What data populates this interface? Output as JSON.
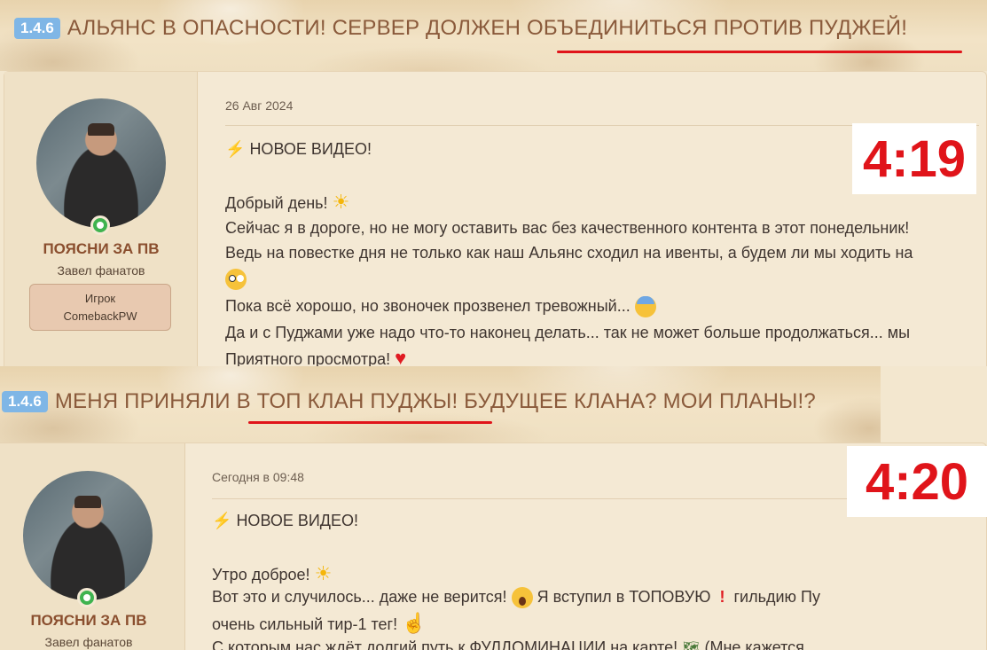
{
  "post1": {
    "version": "1.4.6",
    "title": "АЛЬЯНС В ОПАСНОСТИ! СЕРВЕР ДОЛЖЕН ОБЪЕДИНИТЬСЯ ПРОТИВ ПУДЖЕЙ!",
    "user": {
      "name": "ПОЯСНИ ЗА ПВ",
      "title": "Завел фанатов",
      "role_line1": "Игрок",
      "role_line2": "ComebackPW"
    },
    "date": "26 Авг 2024",
    "lines": [
      "НОВОЕ ВИДЕО!",
      "Добрый день!",
      "Сейчас я в дороге, но не могу оставить вас без качественного контента в этот понедельник!",
      "Ведь на повестке дня не только как наш Альянс сходил на ивенты, а будем ли мы ходить на",
      "",
      "Пока всё хорошо, но звоночек прозвенел тревожный...",
      "Да и с Пуджами уже надо что-то наконец делать... так не может больше продолжаться... мы",
      "Приятного просмотра!"
    ],
    "timestamp": "4:19"
  },
  "post2": {
    "version": "1.4.6",
    "title": "МЕНЯ ПРИНЯЛИ В ТОП КЛАН ПУДЖЫ! БУДУЩЕЕ КЛАНА? МОИ ПЛАНЫ!?",
    "user": {
      "name": "ПОЯСНИ ЗА ПВ",
      "title": "Завел фанатов"
    },
    "date": "Сегодня в 09:48",
    "lines": [
      "НОВОЕ ВИДЕО!",
      "Утро доброе!",
      "Вот это и случилось... даже не верится!",
      "Я вступил в ТОПОВУЮ",
      "гильдию Пу",
      "очень сильный тир-1 тег!",
      "С которым нас ждёт долгий путь к ФУЛДОМИНАЦИИ на карте!",
      "(Мне кажется"
    ],
    "timestamp": "4:20"
  },
  "colors": {
    "accent_red": "#e0141a",
    "version_badge": "#7fb6e6",
    "title_brown": "#8a5a3b"
  },
  "icons": [
    "lightning-icon",
    "sun-emoji-icon",
    "flushed-face-icon",
    "anxious-face-icon",
    "heart-icon",
    "scream-face-icon",
    "exclamation-icon",
    "finger-up-icon",
    "map-icon",
    "online-indicator-icon"
  ]
}
